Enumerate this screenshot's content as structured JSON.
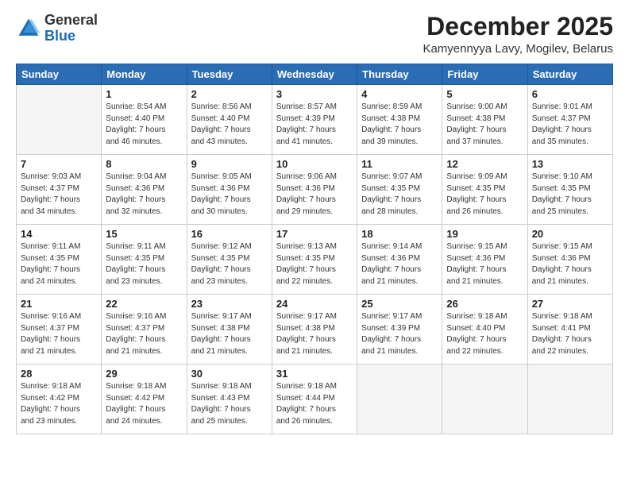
{
  "logo": {
    "general": "General",
    "blue": "Blue"
  },
  "header": {
    "month": "December 2025",
    "location": "Kamyennyya Lavy, Mogilev, Belarus"
  },
  "weekdays": [
    "Sunday",
    "Monday",
    "Tuesday",
    "Wednesday",
    "Thursday",
    "Friday",
    "Saturday"
  ],
  "weeks": [
    [
      {
        "day": "",
        "info": ""
      },
      {
        "day": "1",
        "info": "Sunrise: 8:54 AM\nSunset: 4:40 PM\nDaylight: 7 hours\nand 46 minutes."
      },
      {
        "day": "2",
        "info": "Sunrise: 8:56 AM\nSunset: 4:40 PM\nDaylight: 7 hours\nand 43 minutes."
      },
      {
        "day": "3",
        "info": "Sunrise: 8:57 AM\nSunset: 4:39 PM\nDaylight: 7 hours\nand 41 minutes."
      },
      {
        "day": "4",
        "info": "Sunrise: 8:59 AM\nSunset: 4:38 PM\nDaylight: 7 hours\nand 39 minutes."
      },
      {
        "day": "5",
        "info": "Sunrise: 9:00 AM\nSunset: 4:38 PM\nDaylight: 7 hours\nand 37 minutes."
      },
      {
        "day": "6",
        "info": "Sunrise: 9:01 AM\nSunset: 4:37 PM\nDaylight: 7 hours\nand 35 minutes."
      }
    ],
    [
      {
        "day": "7",
        "info": "Sunrise: 9:03 AM\nSunset: 4:37 PM\nDaylight: 7 hours\nand 34 minutes."
      },
      {
        "day": "8",
        "info": "Sunrise: 9:04 AM\nSunset: 4:36 PM\nDaylight: 7 hours\nand 32 minutes."
      },
      {
        "day": "9",
        "info": "Sunrise: 9:05 AM\nSunset: 4:36 PM\nDaylight: 7 hours\nand 30 minutes."
      },
      {
        "day": "10",
        "info": "Sunrise: 9:06 AM\nSunset: 4:36 PM\nDaylight: 7 hours\nand 29 minutes."
      },
      {
        "day": "11",
        "info": "Sunrise: 9:07 AM\nSunset: 4:35 PM\nDaylight: 7 hours\nand 28 minutes."
      },
      {
        "day": "12",
        "info": "Sunrise: 9:09 AM\nSunset: 4:35 PM\nDaylight: 7 hours\nand 26 minutes."
      },
      {
        "day": "13",
        "info": "Sunrise: 9:10 AM\nSunset: 4:35 PM\nDaylight: 7 hours\nand 25 minutes."
      }
    ],
    [
      {
        "day": "14",
        "info": "Sunrise: 9:11 AM\nSunset: 4:35 PM\nDaylight: 7 hours\nand 24 minutes."
      },
      {
        "day": "15",
        "info": "Sunrise: 9:11 AM\nSunset: 4:35 PM\nDaylight: 7 hours\nand 23 minutes."
      },
      {
        "day": "16",
        "info": "Sunrise: 9:12 AM\nSunset: 4:35 PM\nDaylight: 7 hours\nand 23 minutes."
      },
      {
        "day": "17",
        "info": "Sunrise: 9:13 AM\nSunset: 4:35 PM\nDaylight: 7 hours\nand 22 minutes."
      },
      {
        "day": "18",
        "info": "Sunrise: 9:14 AM\nSunset: 4:36 PM\nDaylight: 7 hours\nand 21 minutes."
      },
      {
        "day": "19",
        "info": "Sunrise: 9:15 AM\nSunset: 4:36 PM\nDaylight: 7 hours\nand 21 minutes."
      },
      {
        "day": "20",
        "info": "Sunrise: 9:15 AM\nSunset: 4:36 PM\nDaylight: 7 hours\nand 21 minutes."
      }
    ],
    [
      {
        "day": "21",
        "info": "Sunrise: 9:16 AM\nSunset: 4:37 PM\nDaylight: 7 hours\nand 21 minutes."
      },
      {
        "day": "22",
        "info": "Sunrise: 9:16 AM\nSunset: 4:37 PM\nDaylight: 7 hours\nand 21 minutes."
      },
      {
        "day": "23",
        "info": "Sunrise: 9:17 AM\nSunset: 4:38 PM\nDaylight: 7 hours\nand 21 minutes."
      },
      {
        "day": "24",
        "info": "Sunrise: 9:17 AM\nSunset: 4:38 PM\nDaylight: 7 hours\nand 21 minutes."
      },
      {
        "day": "25",
        "info": "Sunrise: 9:17 AM\nSunset: 4:39 PM\nDaylight: 7 hours\nand 21 minutes."
      },
      {
        "day": "26",
        "info": "Sunrise: 9:18 AM\nSunset: 4:40 PM\nDaylight: 7 hours\nand 22 minutes."
      },
      {
        "day": "27",
        "info": "Sunrise: 9:18 AM\nSunset: 4:41 PM\nDaylight: 7 hours\nand 22 minutes."
      }
    ],
    [
      {
        "day": "28",
        "info": "Sunrise: 9:18 AM\nSunset: 4:42 PM\nDaylight: 7 hours\nand 23 minutes."
      },
      {
        "day": "29",
        "info": "Sunrise: 9:18 AM\nSunset: 4:42 PM\nDaylight: 7 hours\nand 24 minutes."
      },
      {
        "day": "30",
        "info": "Sunrise: 9:18 AM\nSunset: 4:43 PM\nDaylight: 7 hours\nand 25 minutes."
      },
      {
        "day": "31",
        "info": "Sunrise: 9:18 AM\nSunset: 4:44 PM\nDaylight: 7 hours\nand 26 minutes."
      },
      {
        "day": "",
        "info": ""
      },
      {
        "day": "",
        "info": ""
      },
      {
        "day": "",
        "info": ""
      }
    ]
  ]
}
